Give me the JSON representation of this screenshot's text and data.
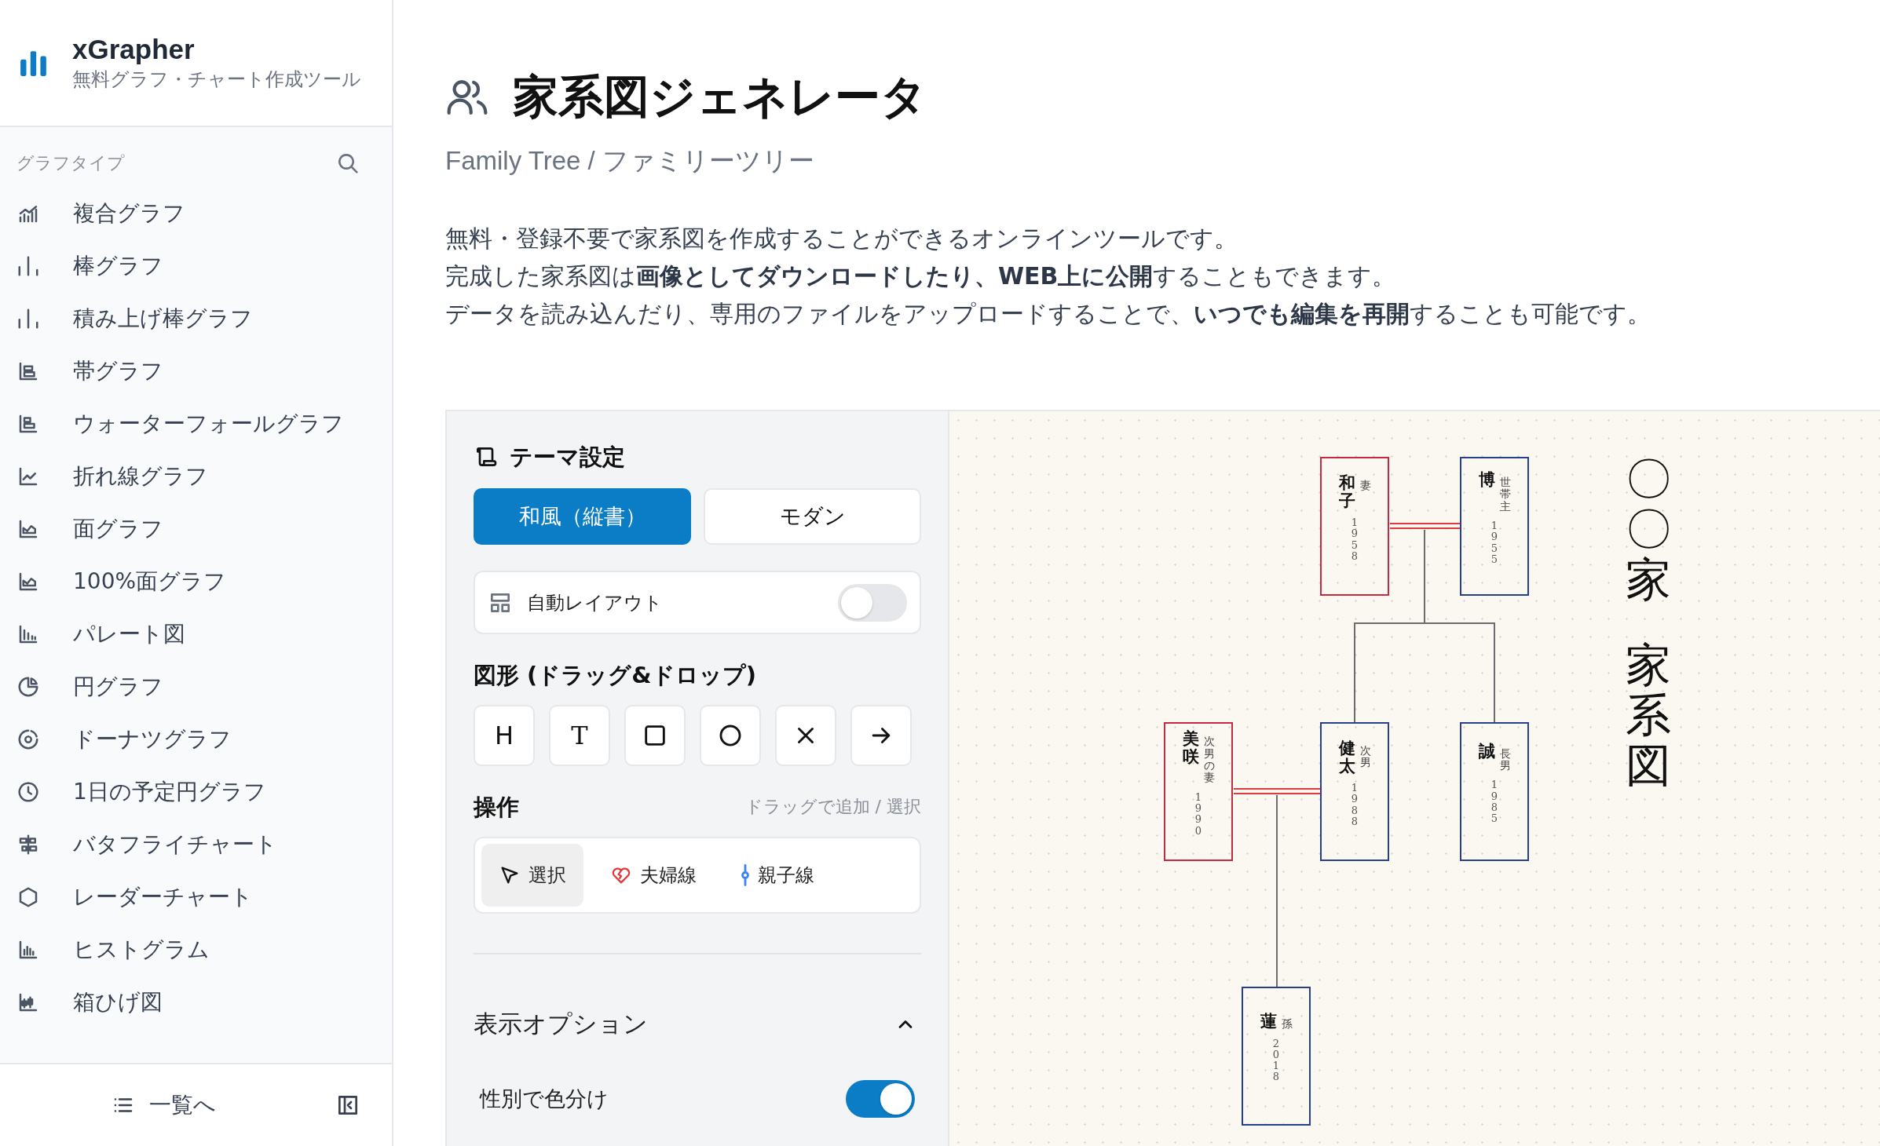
{
  "sidebar": {
    "brand": "xGrapher",
    "tagline": "無料グラフ・チャート作成ツール",
    "section_label": "グラフタイプ",
    "items": [
      {
        "label": "複合グラフ"
      },
      {
        "label": "棒グラフ"
      },
      {
        "label": "積み上げ棒グラフ"
      },
      {
        "label": "帯グラフ"
      },
      {
        "label": "ウォーターフォールグラフ"
      },
      {
        "label": "折れ線グラフ"
      },
      {
        "label": "面グラフ"
      },
      {
        "label": "100%面グラフ"
      },
      {
        "label": "パレート図"
      },
      {
        "label": "円グラフ"
      },
      {
        "label": "ドーナツグラフ"
      },
      {
        "label": "1日の予定円グラフ"
      },
      {
        "label": "バタフライチャート"
      },
      {
        "label": "レーダーチャート"
      },
      {
        "label": "ヒストグラム"
      },
      {
        "label": "箱ひげ図"
      }
    ],
    "footer_button": "一覧へ"
  },
  "page": {
    "title": "家系図ジェネレータ",
    "subtitle": "Family Tree / ファミリーツリー",
    "description": [
      "無料・登録不要で家系図を作成することができるオンラインツールです。",
      "完成した家系図は**画像としてダウンロードしたり、WEB上に公開**することもできます。",
      "データを読み込んだり、専用のファイルをアップロードすることで、**いつでも編集を再開**することも可能です。"
    ]
  },
  "panel": {
    "theme_heading": "テーマ設定",
    "themes": [
      {
        "label": "和風（縦書）",
        "selected": true
      },
      {
        "label": "モダン",
        "selected": false
      }
    ],
    "auto_layout": {
      "label": "自動レイアウト",
      "on": false
    },
    "shapes_heading": "図形 (ドラッグ&ドロップ)",
    "shapes": [
      {
        "kind": "text",
        "label": "H"
      },
      {
        "kind": "text",
        "label": "T"
      },
      {
        "kind": "square"
      },
      {
        "kind": "circle"
      },
      {
        "kind": "cross"
      },
      {
        "kind": "arrow"
      }
    ],
    "operations_heading": "操作",
    "operations_hint": "ドラッグで追加 / 選択",
    "operations": [
      {
        "kind": "select",
        "label": "選択",
        "selected": true
      },
      {
        "kind": "couple",
        "label": "夫婦線",
        "selected": false
      },
      {
        "kind": "parent",
        "label": "親子線",
        "selected": false
      }
    ],
    "display_options": {
      "title": "表示オプション",
      "expanded": true,
      "options": [
        {
          "label": "性別で色分け",
          "on": true
        }
      ]
    }
  },
  "canvas": {
    "family_title": "〇〇家",
    "chart_title": "家系図",
    "people": [
      {
        "name": "和子",
        "role": "妻",
        "year": "1958",
        "kind": "female"
      },
      {
        "name": "博",
        "role": "世帯主",
        "year": "1955",
        "kind": "male"
      },
      {
        "name": "美咲",
        "role": "次男の妻",
        "year": "1990",
        "kind": "female"
      },
      {
        "name": "健太",
        "role": "次男",
        "year": "1988",
        "kind": "male"
      },
      {
        "name": "誠",
        "role": "長男",
        "year": "1985",
        "kind": "male"
      },
      {
        "name": "蓮",
        "role": "孫",
        "year": "2018",
        "kind": "male"
      }
    ]
  }
}
